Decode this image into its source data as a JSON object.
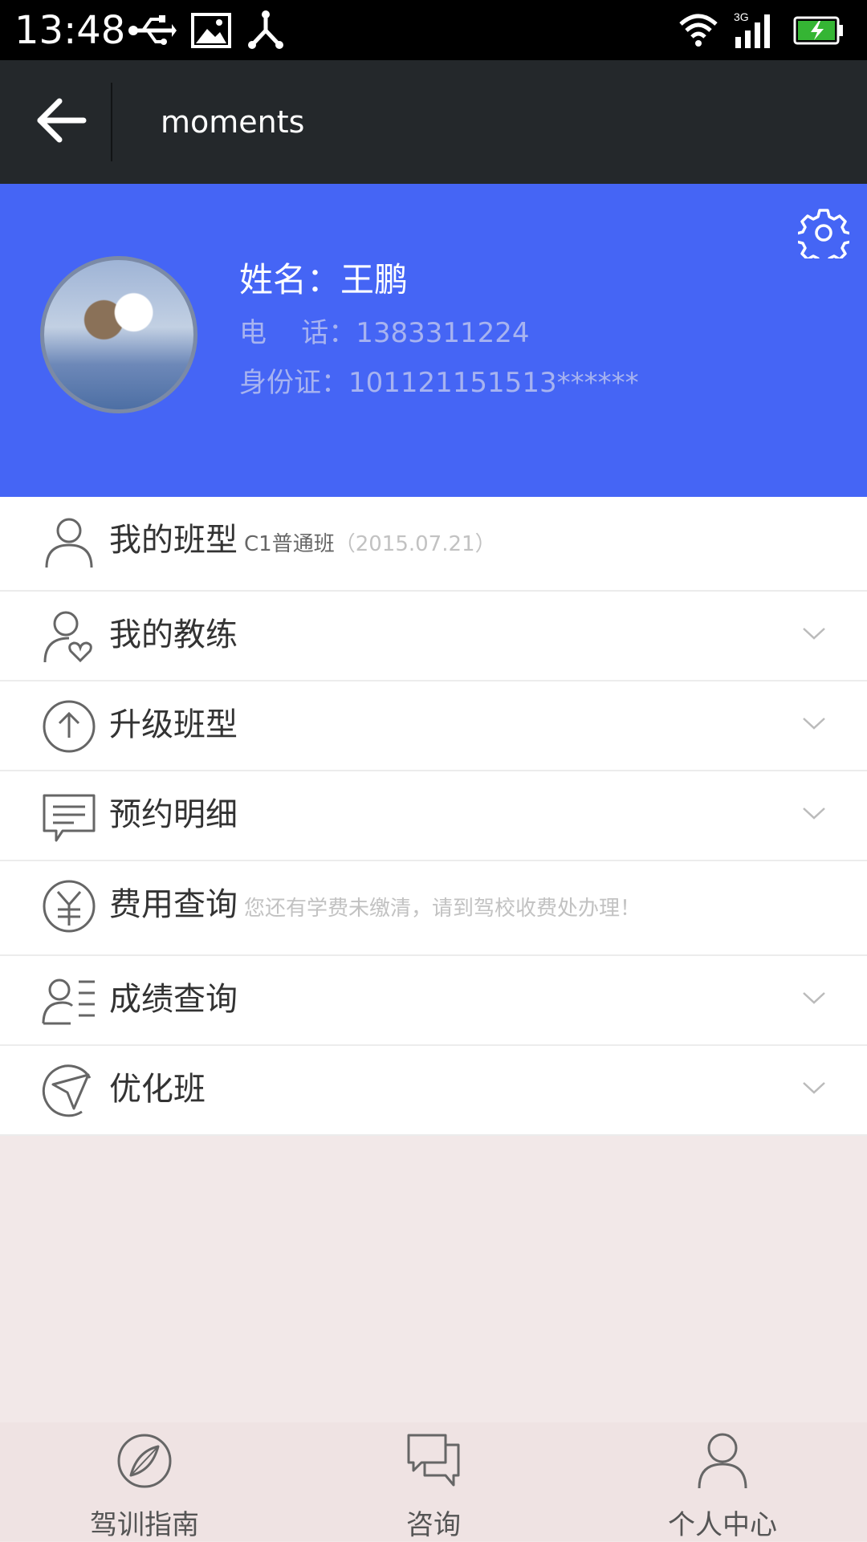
{
  "status_bar": {
    "time": "13:48",
    "icons": [
      "usb-icon",
      "image-icon",
      "share-icon",
      "wifi-icon",
      "signal-3g-icon",
      "battery-charging-icon"
    ]
  },
  "toolbar": {
    "title": "moments",
    "back_icon": "back-arrow-icon"
  },
  "profile": {
    "name_text": "姓名：王鹏",
    "phone_text": "电    话：1383311224",
    "id_text": "身份证：101121151513******",
    "settings_icon": "gear-icon",
    "colors": {
      "background": "#4565f5"
    }
  },
  "menu": {
    "items": [
      {
        "label": "我的班型",
        "sub": "C1普通班",
        "sub2": "（2015.07.21）",
        "icon": "user-icon"
      },
      {
        "label": "我的教练",
        "icon": "user-heart-icon"
      },
      {
        "label": "升级班型",
        "icon": "arrow-up-circle-icon"
      },
      {
        "label": "预约明细",
        "icon": "chat-list-icon"
      },
      {
        "label": "费用查询",
        "note": "您还有学费未缴清，请到驾校收费处办理！",
        "icon": "yen-circle-icon"
      },
      {
        "label": "成绩查询",
        "icon": "user-list-icon"
      },
      {
        "label": "优化班",
        "icon": "send-circle-icon"
      }
    ]
  },
  "bottom_nav": {
    "items": [
      {
        "label": "驾训指南",
        "icon": "compass-icon"
      },
      {
        "label": "咨询",
        "icon": "chat-bubbles-icon"
      },
      {
        "label": "个人中心",
        "icon": "user-icon"
      }
    ]
  }
}
